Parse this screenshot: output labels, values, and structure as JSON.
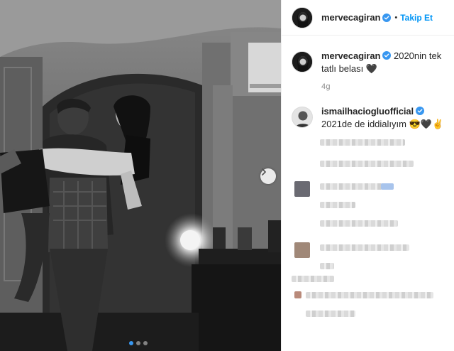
{
  "post": {
    "username": "mervecagiran",
    "follow_label": "Takip Et",
    "separator": "•",
    "caption_username": "mervecagiran",
    "caption_text": "2020nin tek tatlı belası 🖤",
    "time_ago": "4g"
  },
  "comments": [
    {
      "username": "ismailhaciogluofficial",
      "text": "2021de de iddialıyım 😎🖤✌️"
    }
  ],
  "carousel": {
    "dot_count": 3,
    "active_index": 0
  },
  "icons": {
    "verified": "verified-badge-icon",
    "next": "chevron-right-icon"
  },
  "colors": {
    "accent": "#0095f6",
    "verified": "#3897f0",
    "text": "#262626",
    "muted": "#8e8e8e"
  }
}
